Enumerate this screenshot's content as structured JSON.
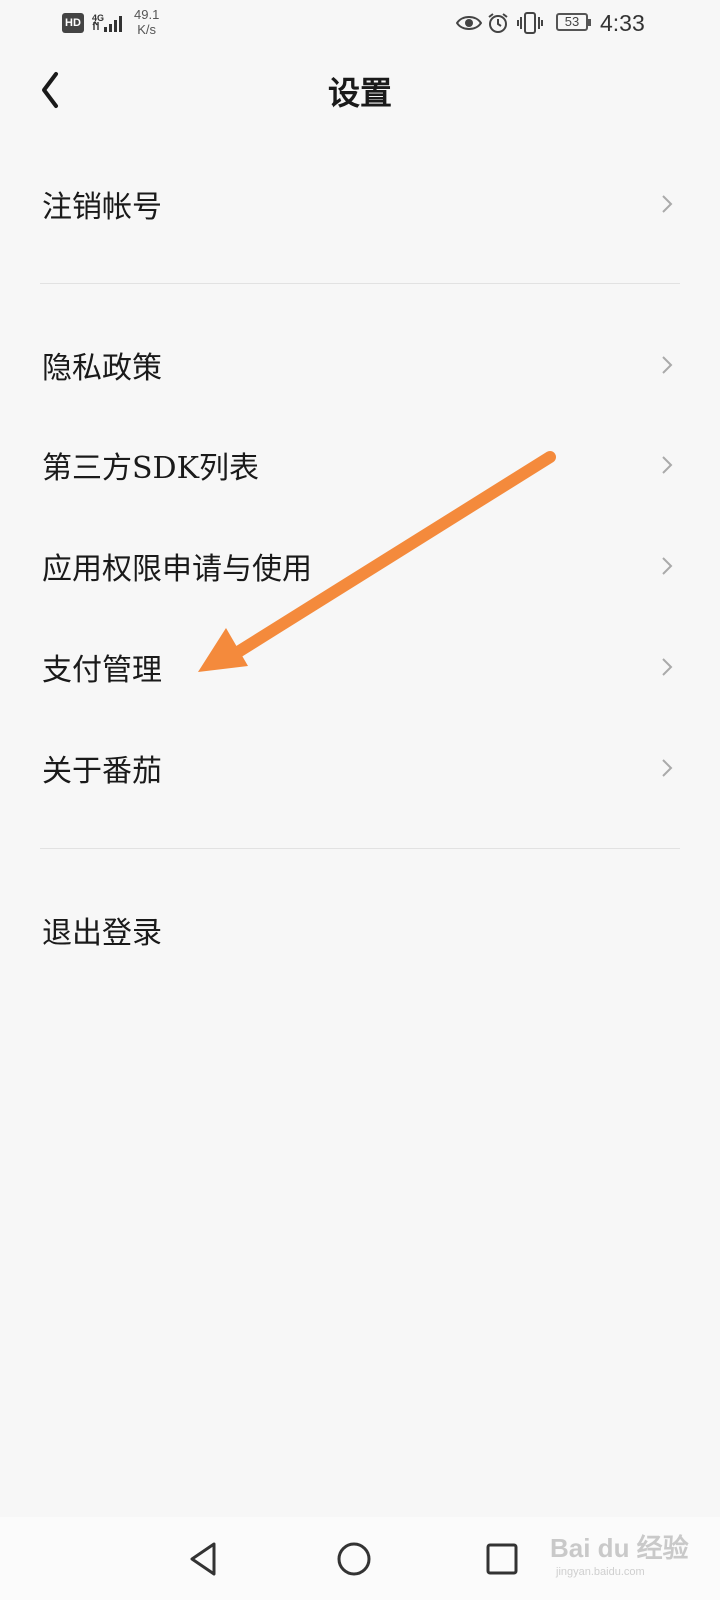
{
  "status_bar": {
    "hd": "HD",
    "network": "4G",
    "speed_value": "49.1",
    "speed_unit": "K/s",
    "battery": "53",
    "time": "4:33",
    "icons": [
      "eye-icon",
      "alarm-icon",
      "vibrate-icon"
    ]
  },
  "header": {
    "title": "设置",
    "back_icon": "chevron-left-icon"
  },
  "settings": {
    "group1": [
      {
        "label": "注销帐号"
      }
    ],
    "group2": [
      {
        "label": "隐私政策"
      },
      {
        "label": "第三方SDK列表"
      },
      {
        "label": "应用权限申请与使用"
      },
      {
        "label": "支付管理"
      },
      {
        "label": "关于番茄"
      }
    ],
    "group3": [
      {
        "label": "退出登录"
      }
    ]
  },
  "annotation": {
    "color": "#f48a3c"
  },
  "nav": {
    "icons": [
      "back-triangle-icon",
      "home-circle-icon",
      "recents-square-icon"
    ]
  },
  "watermark": {
    "text": "Bai du 经验",
    "sub": "jingyan.baidu.com"
  }
}
